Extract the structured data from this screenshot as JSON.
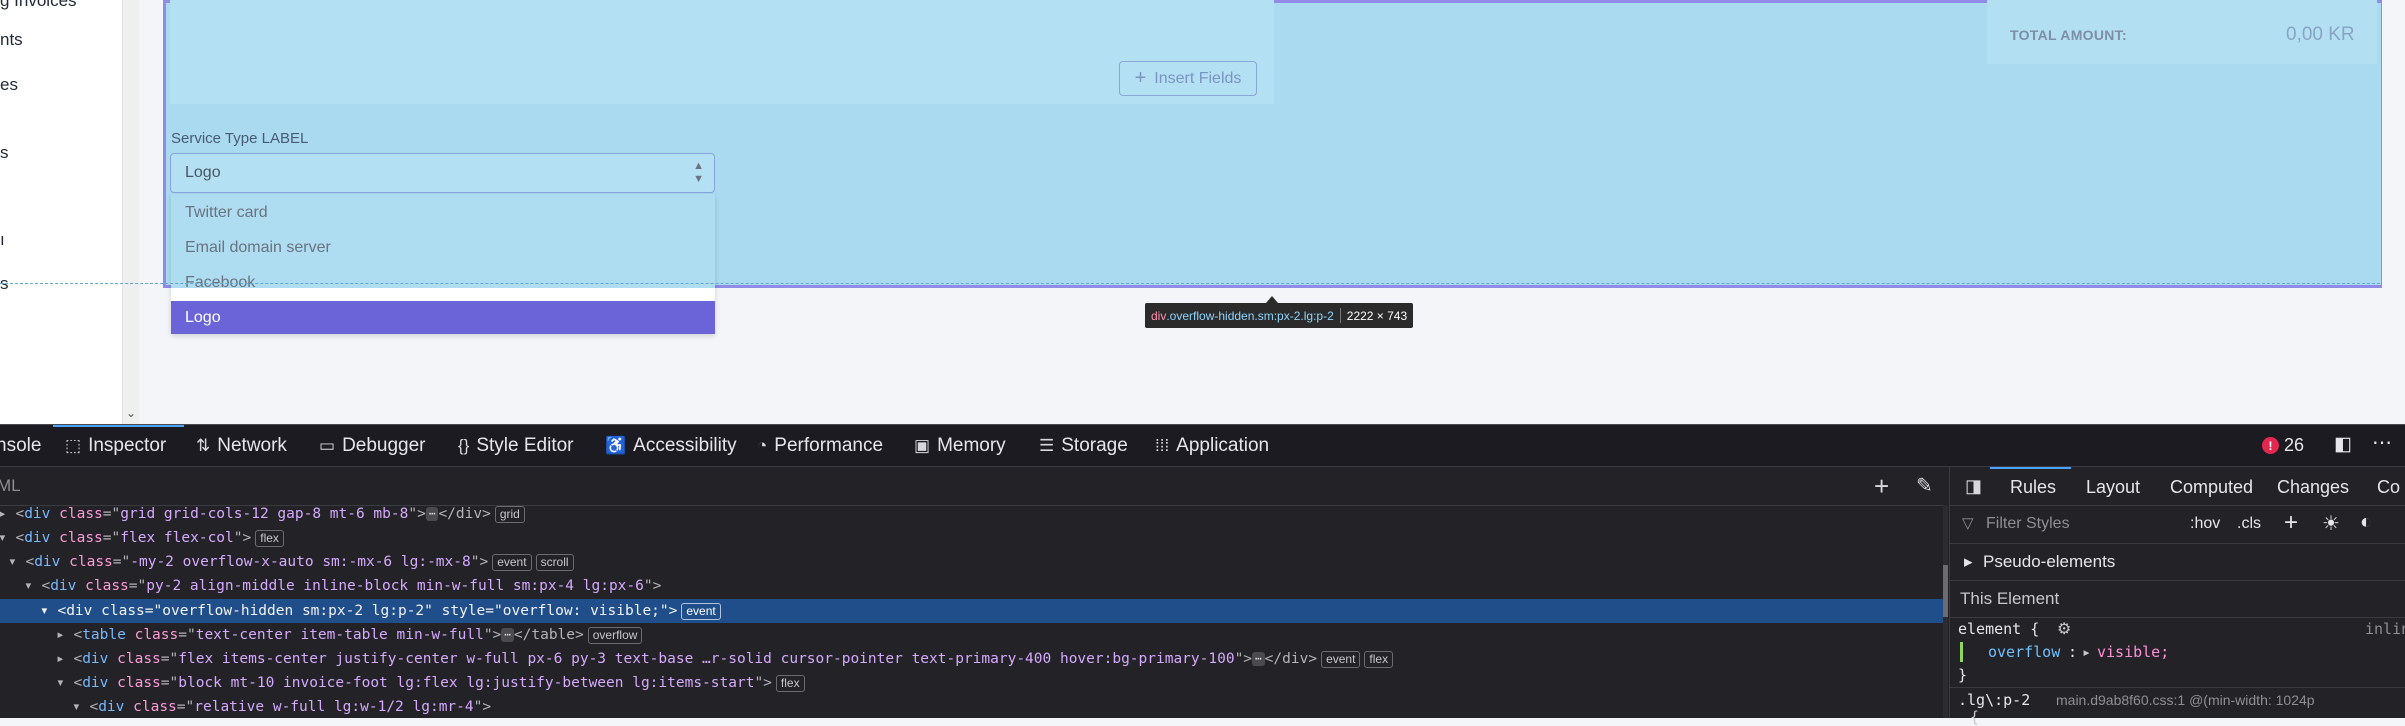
{
  "sidebar": {
    "items": [
      {
        "label": "g Invoices"
      },
      {
        "label": "nts"
      },
      {
        "label": "es"
      },
      {
        "label": "s"
      },
      {
        "label": "ı"
      },
      {
        "label": "s"
      }
    ]
  },
  "page": {
    "total_amount_label": "TOTAL AMOUNT:",
    "total_amount_value": "0,00 KR",
    "insert_fields_label": "Insert Fields",
    "service_type_label": "Service Type LABEL",
    "service_select_value": "Logo",
    "dropdown_options": [
      "Twitter card",
      "Email domain server",
      "Facebook",
      "Logo"
    ],
    "tooltip": {
      "tag": "div",
      "classes": ".overflow-hidden.sm:px-2.lg:p-2",
      "size": "2222 × 743"
    }
  },
  "devtools": {
    "tabs": [
      "nsole",
      "Inspector",
      "Network",
      "Debugger",
      "Style Editor",
      "Accessibility",
      "Performance",
      "Memory",
      "Storage",
      "Application"
    ],
    "active_tab": "Inspector",
    "error_count": "26",
    "search_placeholder": "ML",
    "dom_lines": [
      {
        "open": "<",
        "tag": "div",
        "attr": "class",
        "value": "grid grid-cols-12 gap-8 mt-6 mb-8",
        "tail": "</div>",
        "badges": [
          "grid"
        ]
      },
      {
        "open": "<",
        "tag": "div",
        "attr": "class",
        "value": "flex flex-col",
        "tail": "",
        "badges": [
          "flex"
        ]
      },
      {
        "open": "<",
        "tag": "div",
        "attr": "class",
        "value": "-my-2 overflow-x-auto sm:-mx-6 lg:-mx-8",
        "tail": "",
        "badges": [
          "event",
          "scroll"
        ]
      },
      {
        "open": "<",
        "tag": "div",
        "attr": "class",
        "value": "py-2 align-middle inline-block min-w-full sm:px-4 lg:px-6",
        "tail": "",
        "badges": []
      },
      {
        "open": "<",
        "tag": "div",
        "attr": "class",
        "value": "overflow-hidden sm:px-2 lg:p-2",
        "attr2": "style",
        "value2": "overflow: visible;",
        "tail": "",
        "badges": [
          "event"
        ]
      },
      {
        "open": "<",
        "tag": "table",
        "attr": "class",
        "value": "text-center item-table min-w-full",
        "tail": "</table>",
        "badges": [
          "overflow"
        ]
      },
      {
        "open": "<",
        "tag": "div",
        "attr": "class",
        "value": "flex items-center justify-center w-full px-6 py-3 text-base …r-solid cursor-pointer text-primary-400 hover:bg-primary-100",
        "tail": "</div>",
        "badges": [
          "event",
          "flex"
        ]
      },
      {
        "open": "<",
        "tag": "div",
        "attr": "class",
        "value": "block mt-10 invoice-foot lg:flex lg:justify-between lg:items-start",
        "tail": "",
        "badges": [
          "flex"
        ]
      },
      {
        "open": "<",
        "tag": "div",
        "attr": "class",
        "value": "relative w-full lg:w-1/2 lg:mr-4",
        "tail": "",
        "badges": []
      }
    ],
    "rules": {
      "tabs": [
        "Rules",
        "Layout",
        "Computed",
        "Changes",
        "Co"
      ],
      "active": "Rules",
      "filter_placeholder": "Filter Styles",
      "hov": ":hov",
      "cls": ".cls",
      "pseudo_elements": "Pseudo-elements",
      "this_element": "This Element",
      "element_rule": "element {",
      "inline": "inlin",
      "prop": "overflow",
      "prop_value": "visible;",
      "close_brace": "}",
      "next_selector": ".lg\\:p-2",
      "next_source": "main.d9ab8f60.css:1 @(min-width: 1024p"
    }
  }
}
